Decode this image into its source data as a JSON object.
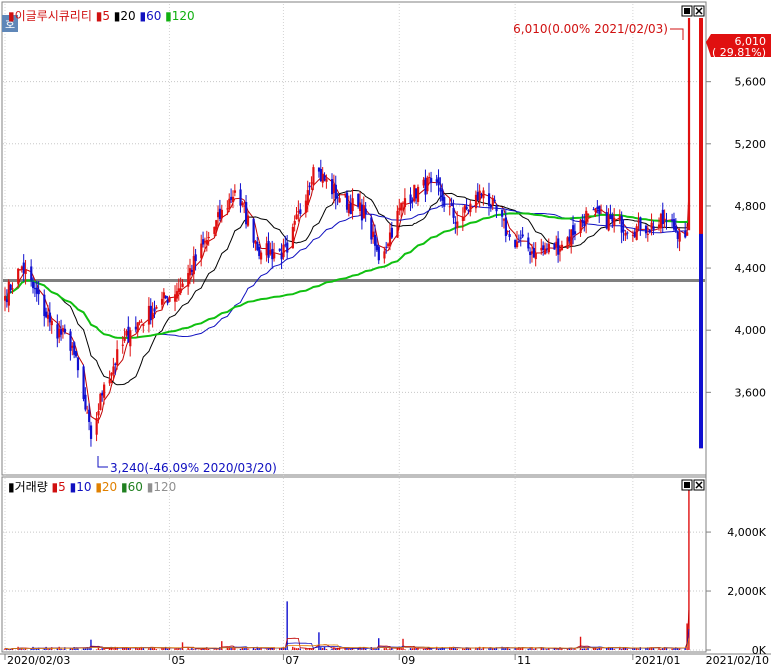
{
  "panel_icon": "호",
  "price_legend": [
    {
      "text": "이글루시큐리티",
      "color": "#d01010"
    },
    {
      "text": "5",
      "color": "#d01010"
    },
    {
      "text": "20",
      "color": "#000000"
    },
    {
      "text": "60",
      "color": "#1010c0"
    },
    {
      "text": "120",
      "color": "#10b010"
    }
  ],
  "volume_legend": [
    {
      "text": "거래량",
      "color": "#000000"
    },
    {
      "text": "5",
      "color": "#d01010"
    },
    {
      "text": "10",
      "color": "#1010c0"
    },
    {
      "text": "20",
      "color": "#e08000"
    },
    {
      "text": "60",
      "color": "#208020"
    },
    {
      "text": "120",
      "color": "#909090"
    }
  ],
  "annotations": {
    "high": "6,010(0.00% 2021/02/03)",
    "low": "3,240(-46.09% 2020/03/20)"
  },
  "current_price": {
    "value": "6,010",
    "change": "( 29.81%)"
  },
  "colors": {
    "up": "#e01010",
    "down": "#1010d0",
    "ma5": "#c00000",
    "ma20": "#000000",
    "ma60": "#1010c0",
    "ma120": "#10c010",
    "hline": "#808080"
  },
  "chart_data": [
    {
      "type": "candlestick",
      "title": "이글루시큐리티",
      "x_start": "2020/02/03",
      "x_end": "2021/02/10",
      "x_tick_labels": [
        "2020/02/03",
        "05",
        "07",
        "09",
        "11",
        "2021/01",
        "2021/02/10"
      ],
      "y_tick_labels": [
        "3,600",
        "4,000",
        "4,400",
        "4,800",
        "5,200",
        "5,600"
      ],
      "y_ticks": [
        3600,
        4000,
        4400,
        4800,
        5200,
        5600
      ],
      "ylim": [
        3100,
        6100
      ],
      "moving_averages": [
        "5",
        "20",
        "60",
        "120"
      ],
      "horizontal_line": 4320,
      "close_anchors": [
        {
          "date": "2020/02/03",
          "close": 4220
        },
        {
          "date": "2020/02/12",
          "close": 4410
        },
        {
          "date": "2020/02/27",
          "close": 4050
        },
        {
          "date": "2020/03/10",
          "close": 3900
        },
        {
          "date": "2020/03/20",
          "close": 3300
        },
        {
          "date": "2020/03/27",
          "close": 3650
        },
        {
          "date": "2020/04/10",
          "close": 4000
        },
        {
          "date": "2020/04/24",
          "close": 4150
        },
        {
          "date": "2020/05/08",
          "close": 4300
        },
        {
          "date": "2020/05/22",
          "close": 4600
        },
        {
          "date": "2020/06/05",
          "close": 4900
        },
        {
          "date": "2020/06/19",
          "close": 4500
        },
        {
          "date": "2020/07/03",
          "close": 4500
        },
        {
          "date": "2020/07/17",
          "close": 5050
        },
        {
          "date": "2020/07/31",
          "close": 4850
        },
        {
          "date": "2020/08/14",
          "close": 4750
        },
        {
          "date": "2020/08/21",
          "close": 4450
        },
        {
          "date": "2020/09/04",
          "close": 4850
        },
        {
          "date": "2020/09/18",
          "close": 4950
        },
        {
          "date": "2020/10/02",
          "close": 4700
        },
        {
          "date": "2020/10/16",
          "close": 4900
        },
        {
          "date": "2020/10/30",
          "close": 4600
        },
        {
          "date": "2020/11/13",
          "close": 4500
        },
        {
          "date": "2020/11/27",
          "close": 4550
        },
        {
          "date": "2020/12/11",
          "close": 4750
        },
        {
          "date": "2020/12/24",
          "close": 4700
        },
        {
          "date": "2021/01/08",
          "close": 4650
        },
        {
          "date": "2021/01/22",
          "close": 4700
        },
        {
          "date": "2021/01/29",
          "close": 4630
        },
        {
          "date": "2021/02/02",
          "close": 4630
        },
        {
          "date": "2021/02/03",
          "close": 6010
        }
      ]
    },
    {
      "type": "bar",
      "title": "거래량",
      "y_tick_labels": [
        "0K",
        "2,000K",
        "4,000K"
      ],
      "y_ticks": [
        0,
        2000,
        4000
      ],
      "ylim": [
        0,
        5800
      ],
      "unit": "K",
      "spikes": [
        {
          "date": "2020/03/20",
          "value": 350
        },
        {
          "date": "2020/05/08",
          "value": 260
        },
        {
          "date": "2020/05/29",
          "value": 300
        },
        {
          "date": "2020/07/03",
          "value": 1650
        },
        {
          "date": "2020/07/20",
          "value": 600
        },
        {
          "date": "2020/08/21",
          "value": 400
        },
        {
          "date": "2020/09/03",
          "value": 380
        },
        {
          "date": "2020/12/07",
          "value": 450
        },
        {
          "date": "2021/02/02",
          "value": 900
        },
        {
          "date": "2021/02/03",
          "value": 5700
        }
      ]
    }
  ]
}
